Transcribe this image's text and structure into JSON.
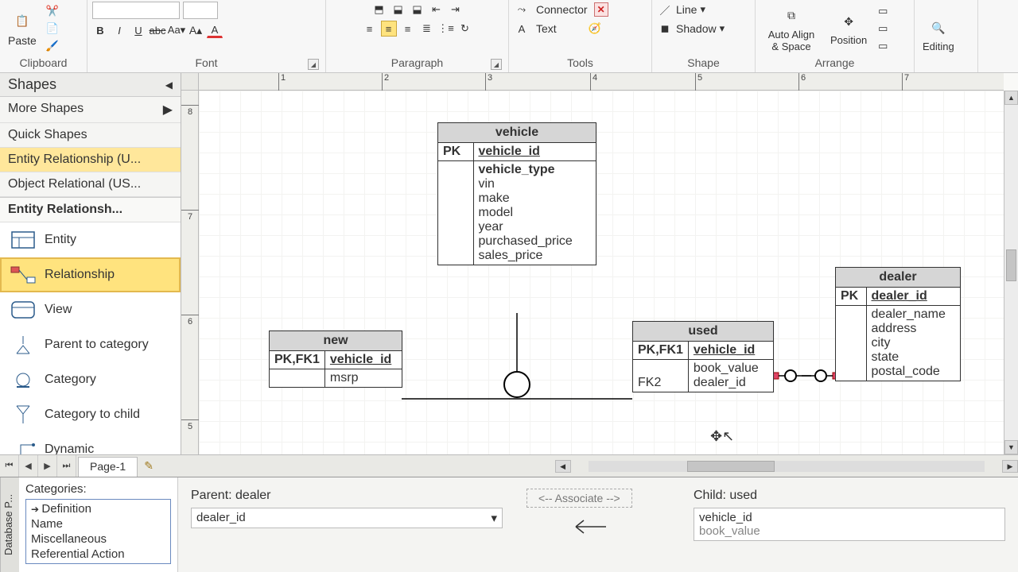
{
  "ribbon": {
    "clipboard": {
      "paste": "Paste",
      "label": "Clipboard"
    },
    "font": {
      "label": "Font"
    },
    "paragraph": {
      "label": "Paragraph"
    },
    "tools": {
      "connector": "Connector",
      "text": "Text",
      "label": "Tools",
      "close": "✕"
    },
    "shape": {
      "line": "Line",
      "shadow": "Shadow",
      "label": "Shape"
    },
    "arrange": {
      "auto_align": "Auto Align & Space",
      "position": "Position",
      "label": "Arrange"
    },
    "editing": {
      "label": "Editing"
    }
  },
  "shapesPane": {
    "title": "Shapes",
    "rows": {
      "more": "More Shapes",
      "quick": "Quick Shapes",
      "er": "Entity Relationship (U...",
      "or": "Object Relational (US..."
    },
    "stencil": {
      "head": "Entity Relationsh...",
      "items": {
        "entity": "Entity",
        "relationship": "Relationship",
        "view": "View",
        "parent_to_cat": "Parent to category",
        "category": "Category",
        "cat_to_child": "Category to child",
        "dynamic": "Dynamic"
      }
    }
  },
  "ruler": {
    "h": [
      "1",
      "2",
      "3",
      "4",
      "5",
      "6",
      "7"
    ],
    "v": [
      "8",
      "7",
      "6",
      "5"
    ]
  },
  "entities": {
    "vehicle": {
      "name": "vehicle",
      "pk_key": "PK",
      "pk_col": "vehicle_id",
      "attrs": [
        "vehicle_type",
        "vin",
        "make",
        "model",
        "year",
        "purchased_price",
        "sales_price"
      ]
    },
    "new": {
      "name": "new",
      "pk_key": "PK,FK1",
      "pk_col": "vehicle_id",
      "attrs": [
        "msrp"
      ]
    },
    "used": {
      "name": "used",
      "pk_key": "PK,FK1",
      "pk_col": "vehicle_id",
      "fk2_key": "FK2",
      "attrs": [
        "book_value",
        "dealer_id"
      ]
    },
    "dealer": {
      "name": "dealer",
      "pk_key": "PK",
      "pk_col": "dealer_id",
      "attrs": [
        "dealer_name",
        "address",
        "city",
        "state",
        "postal_code"
      ]
    }
  },
  "pageTabs": {
    "page": "Page-1"
  },
  "dbprops": {
    "vtab": "Database P...",
    "catHead": "Categories:",
    "cats": [
      "Definition",
      "Name",
      "Miscellaneous",
      "Referential Action"
    ],
    "parentLbl": "Parent: dealer",
    "childLbl": "Child: used",
    "parentCol": "dealer_id",
    "childCols": [
      "vehicle_id",
      "book_value"
    ],
    "assoc": "<-- Associate -->"
  }
}
